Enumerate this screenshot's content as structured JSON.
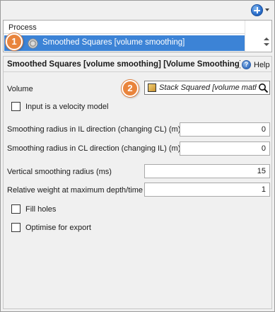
{
  "toolbar": {
    "add_icon": "plus-circle-icon",
    "dropdown_icon": "chevron-down-icon"
  },
  "process_list": {
    "header": "Process",
    "selected_item": "Smoothed Squares [volume smoothing]",
    "item_icon": "gear-icon"
  },
  "callouts": {
    "first": "1",
    "second": "2"
  },
  "panel": {
    "title": "Smoothed Squares [volume smoothing] [Volume Smoothing]",
    "help_label": "Help",
    "volume_label": "Volume",
    "volume_value": "Stack Squared [volume math]",
    "velocity_checkbox_label": "Input is a velocity model",
    "il_radius_label": "Smoothing radius in IL direction (changing CL) (m)",
    "il_radius_value": "0",
    "cl_radius_label": "Smoothing radius in CL direction (changing IL) (m)",
    "cl_radius_value": "0",
    "vertical_radius_label": "Vertical smoothing radius (ms)",
    "vertical_radius_value": "15",
    "relative_weight_label": "Relative weight at maximum depth/time",
    "relative_weight_value": "1",
    "fill_holes_label": "Fill holes",
    "optimise_label": "Optimise for export"
  },
  "colors": {
    "selection": "#3c83d6",
    "callout": "#e9843c",
    "accent_blue": "#2f74d0"
  }
}
